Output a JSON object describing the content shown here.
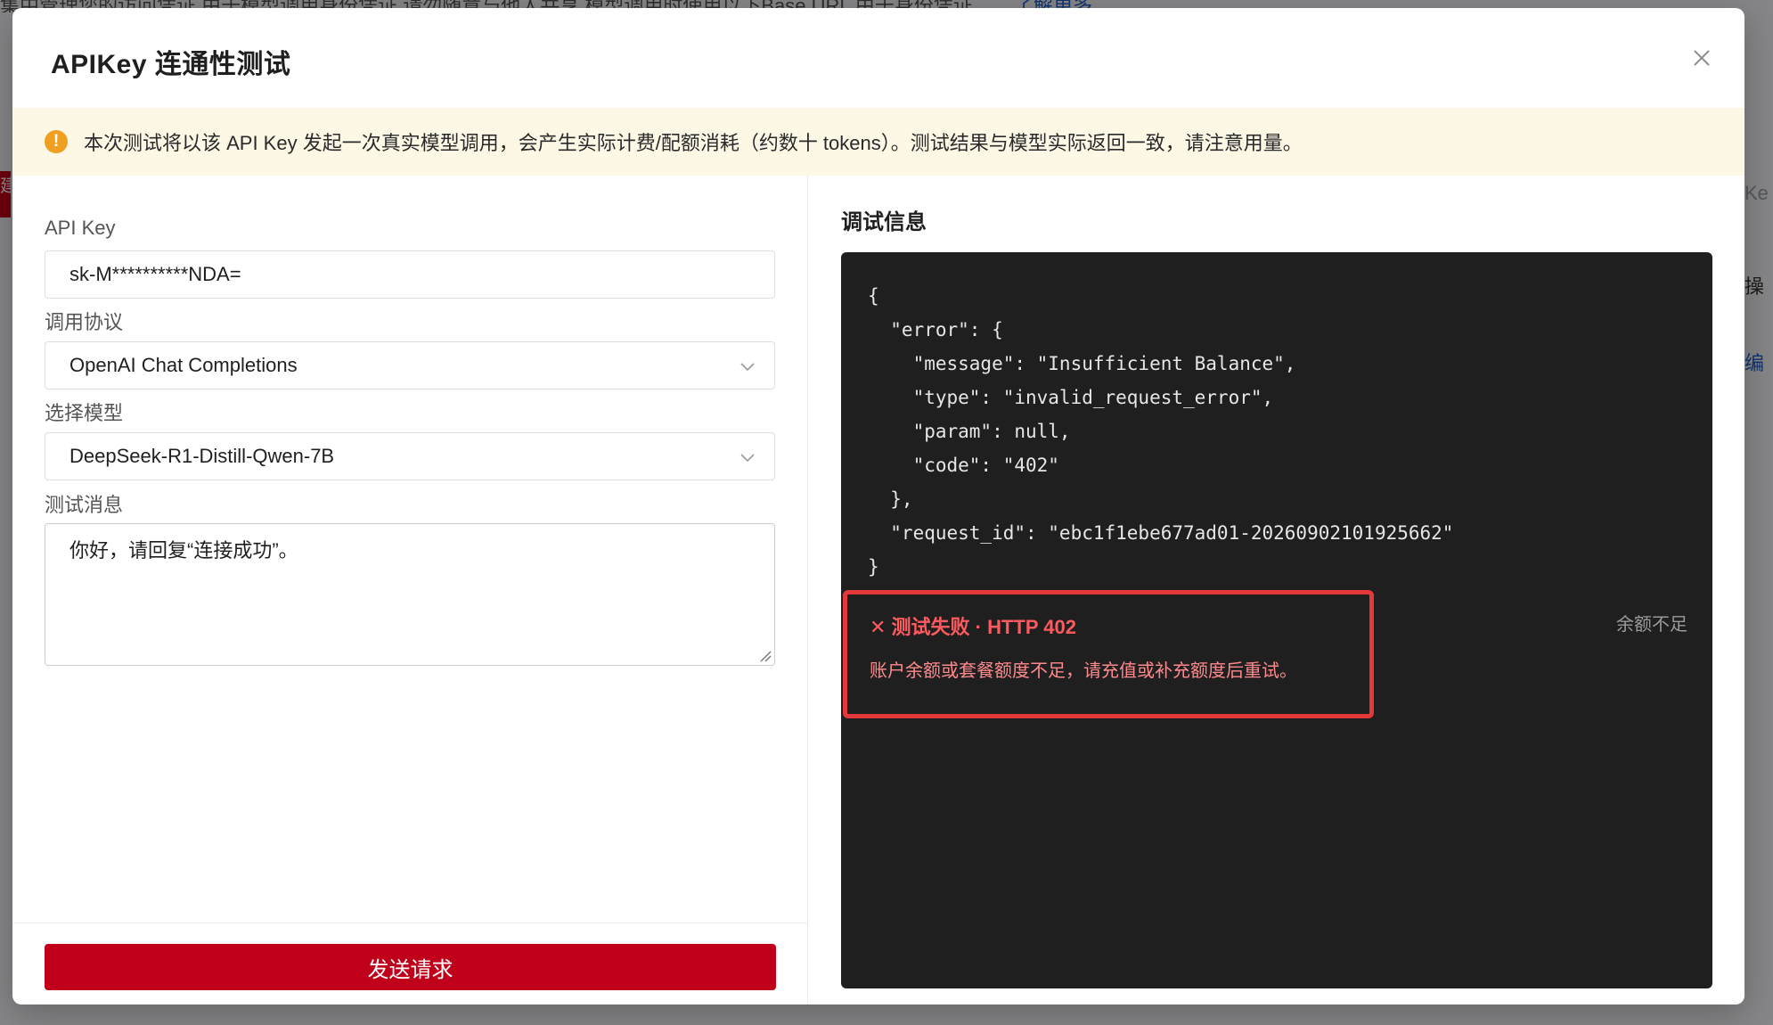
{
  "background": {
    "top_text": "集中管理您的访问凭证 由于模型调用身份凭证 请勿随意与他人共享    模型调用时使用以下Base URL 由于身份凭证",
    "top_link": "了解更多",
    "red_tab_text": "建",
    "right_texts": [
      "Ke",
      "操",
      "编"
    ]
  },
  "modal": {
    "title": "APIKey 连通性测试",
    "close_icon": "close-icon"
  },
  "notice": {
    "icon": "!",
    "text": "本次测试将以该 API Key 发起一次真实模型调用，会产生实际计费/配额消耗（约数十 tokens）。测试结果与模型实际返回一致，请注意用量。"
  },
  "form": {
    "api_key_label": "API Key",
    "api_key_value": "sk-M**********NDA=",
    "protocol_label": "调用协议",
    "protocol_value": "OpenAI Chat Completions",
    "model_label": "选择模型",
    "model_value": "DeepSeek-R1-Distill-Qwen-7B",
    "message_label": "测试消息",
    "message_value": "你好，请回复“连接成功”。",
    "send_label": "发送请求"
  },
  "debug": {
    "title": "调试信息",
    "response_json": "{\n  \"error\": {\n    \"message\": \"Insufficient Balance\",\n    \"type\": \"invalid_request_error\",\n    \"param\": null,\n    \"code\": \"402\"\n  },\n  \"request_id\": \"ebc1f1ebe677ad01-20260902101925662\"\n}",
    "error_title": "✕ 测试失败 · HTTP 402",
    "error_desc": "账户余额或套餐额度不足，请充值或补充额度后重试。",
    "error_tag": "余额不足"
  },
  "colors": {
    "brand_red": "#c0001a",
    "error_red": "#e5383b",
    "warn_orange": "#f0a020",
    "console_bg": "#1f1f1f"
  }
}
